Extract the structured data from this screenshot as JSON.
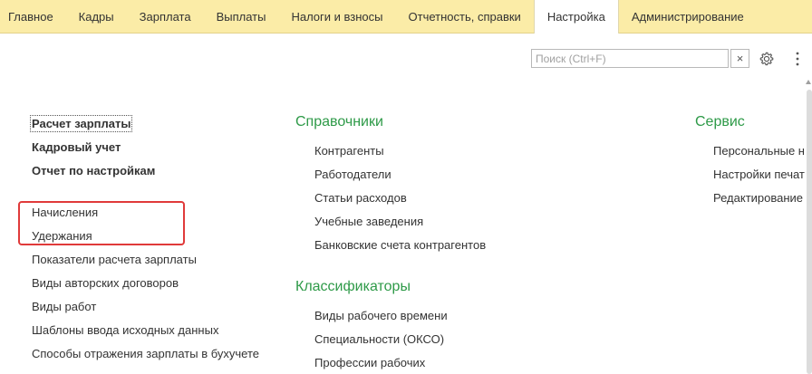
{
  "topmenu": {
    "tabs": [
      {
        "label": "Главное"
      },
      {
        "label": "Кадры"
      },
      {
        "label": "Зарплата"
      },
      {
        "label": "Выплаты"
      },
      {
        "label": "Налоги и взносы"
      },
      {
        "label": "Отчетность, справки"
      },
      {
        "label": "Настройка",
        "active": true
      },
      {
        "label": "Администрирование"
      }
    ],
    "background": "#fbeca7"
  },
  "search": {
    "placeholder": "Поиск (Ctrl+F)",
    "clear_icon": "×",
    "settings_icon": "gear-icon",
    "more_icon": "vertical-dots-icon"
  },
  "left": {
    "links_bold": [
      "Расчет зарплаты",
      "Кадровый учет",
      "Отчет по настройкам"
    ],
    "links": [
      "Начисления",
      "Удержания",
      "Показатели расчета зарплаты",
      "Виды авторских договоров",
      "Виды работ",
      "Шаблоны ввода исходных данных",
      "Способы отражения зарплаты в бухучете"
    ]
  },
  "middle": {
    "section1_title": "Справочники",
    "section1_links": [
      "Контрагенты",
      "Работодатели",
      "Статьи расходов",
      "Учебные заведения",
      "Банковские счета контрагентов"
    ],
    "section2_title": "Классификаторы",
    "section2_links": [
      "Виды рабочего времени",
      "Специальности (ОКСО)",
      "Профессии рабочих"
    ]
  },
  "right": {
    "section_title": "Сервис",
    "links": [
      "Персональные на",
      "Настройки печатн",
      "Редактирование"
    ]
  },
  "colors": {
    "section_title": "#2e9a48",
    "highlight_border": "#e03a3a"
  }
}
